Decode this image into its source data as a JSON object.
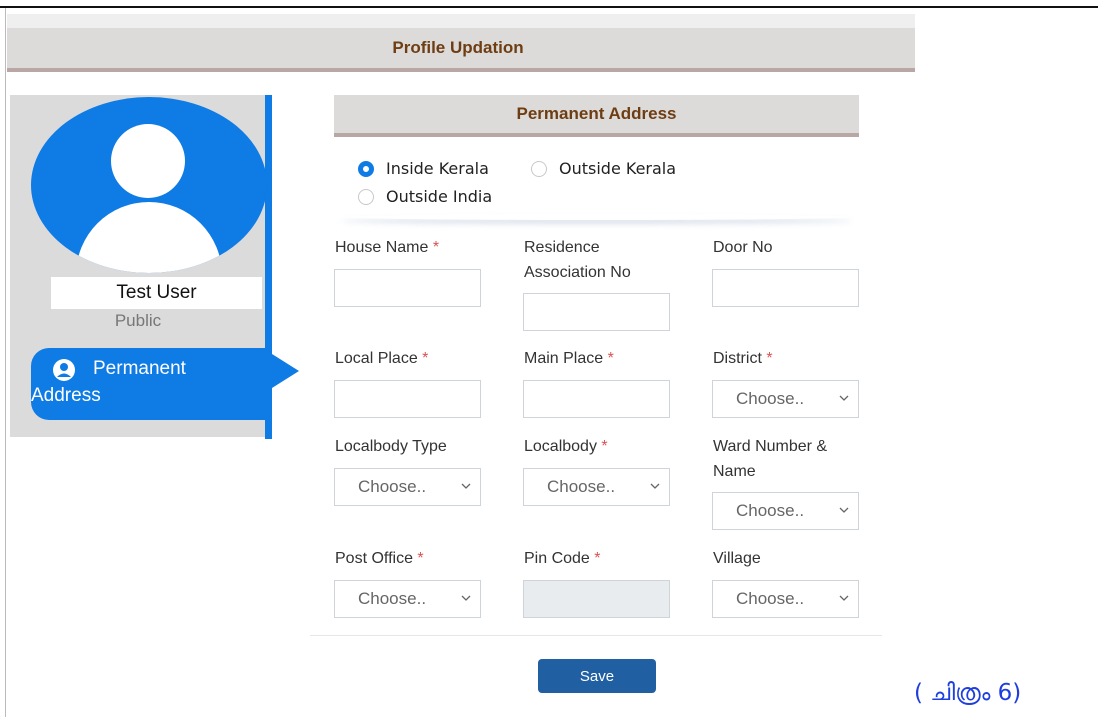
{
  "header": {
    "title": "Profile Updation"
  },
  "profile": {
    "name": "Test User",
    "role": "Public",
    "nav_label": "Permanent Address",
    "nav_label_line1": "Permanent",
    "nav_label_line2": "Address"
  },
  "section": {
    "title": "Permanent Address"
  },
  "address_type": {
    "options": [
      "Inside Kerala",
      "Outside Kerala",
      "Outside India"
    ],
    "selected": "Inside Kerala"
  },
  "fields": {
    "house_name": {
      "label": "House Name",
      "required": "*"
    },
    "residence_association_no": {
      "label_line1": "Residence",
      "label_line2": "Association No"
    },
    "door_no": {
      "label": "Door No"
    },
    "local_place": {
      "label": "Local Place",
      "required": "*"
    },
    "main_place": {
      "label": "Main Place",
      "required": "*"
    },
    "district": {
      "label": "District",
      "required": "*",
      "value": "Choose.."
    },
    "localbody_type": {
      "label": "Localbody Type",
      "value": "Choose.."
    },
    "localbody": {
      "label": "Localbody",
      "required": "*",
      "value": "Choose.."
    },
    "ward": {
      "label_line1": "Ward Number &",
      "label_line2": "Name",
      "value": "Choose.."
    },
    "post_office": {
      "label": "Post Office",
      "required": "*",
      "value": "Choose.."
    },
    "pin_code": {
      "label": "Pin Code",
      "required": "*"
    },
    "village": {
      "label": "Village",
      "value": "Choose.."
    }
  },
  "actions": {
    "save": "Save"
  },
  "caption": "( ചിത്രം 6)",
  "colors": {
    "accent": "#0f7be5",
    "header_text": "#6e3d13",
    "save_button": "#1f5fa2",
    "required": "#d9534f",
    "caption": "#1e3edd"
  },
  "icons": {
    "user": "user-circle-icon",
    "select": "chevron-down-icon"
  }
}
